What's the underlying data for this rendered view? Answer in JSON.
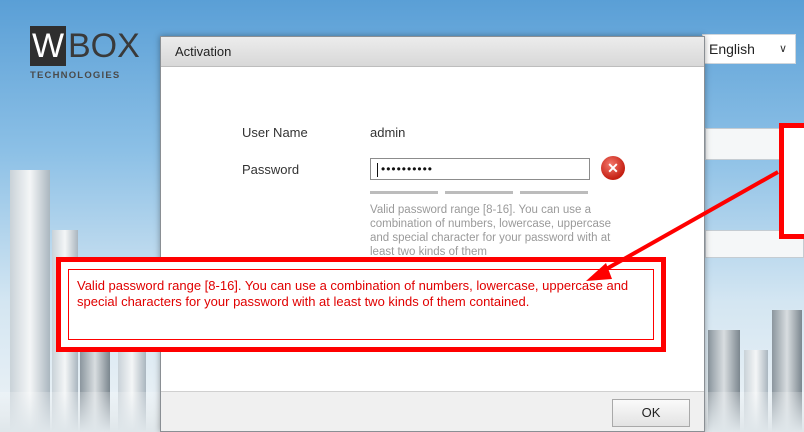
{
  "logo": {
    "w": "W",
    "box": "BOX",
    "tagline": "TECHNOLOGIES"
  },
  "language": {
    "selected": "English"
  },
  "dialog": {
    "title": "Activation",
    "username_label": "User Name",
    "username_value": "admin",
    "password_label": "Password",
    "password_value": "••••••••••",
    "hint": "Valid password range [8-16]. You can use a combination of numbers, lowercase, uppercase and special character for your password with at least two kinds of them",
    "ok_label": "OK"
  },
  "annotation": {
    "text": "Valid password range [8-16]. You can use a combination of numbers, lowercase, uppercase and special characters for your password with at least two kinds of them contained."
  },
  "colors": {
    "annotation": "#ff0000",
    "clear_button": "#d32a1e"
  },
  "icons": {
    "clear": "clear-x-icon",
    "dropdown": "chevron-down-icon"
  }
}
